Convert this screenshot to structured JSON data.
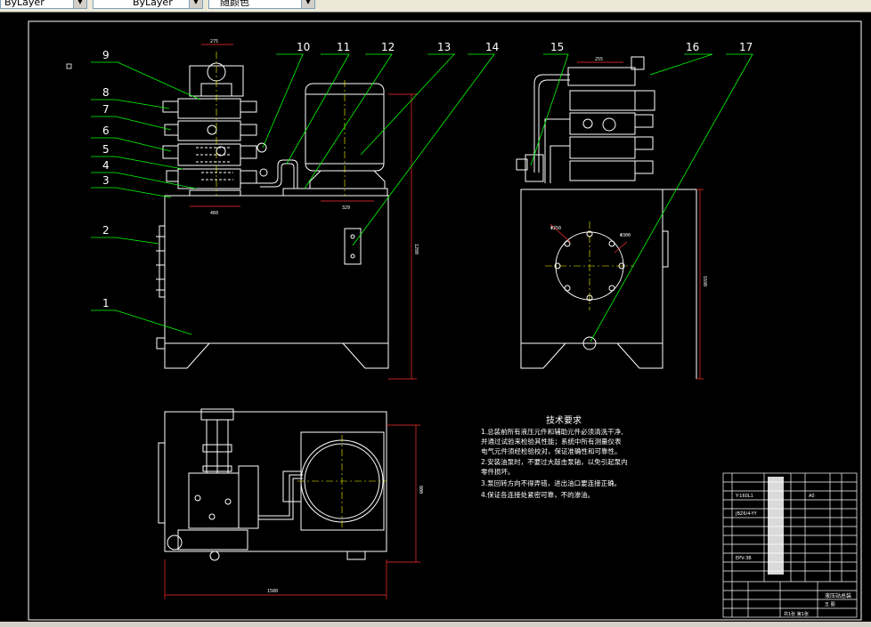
{
  "toolbar": {
    "layer_combo": "ByLayer",
    "linetype_combo": "ByLayer",
    "lineweight_combo": "随颜色"
  },
  "drawing": {
    "part_numbers": [
      "1",
      "2",
      "3",
      "4",
      "5",
      "6",
      "7",
      "8",
      "9",
      "10",
      "11",
      "12",
      "13",
      "14",
      "15",
      "16",
      "17"
    ],
    "dims": {
      "top_width": "275",
      "manifold_width": "460",
      "motor_base": "329",
      "front_height": "1280",
      "side_top": "255",
      "side_height": "1690",
      "flange_a": "Φ250",
      "flange_b": "Φ300",
      "plan_depth": "800",
      "plan_width": "1580"
    },
    "tech_title": "技术要求",
    "tech_lines": [
      "1.总装前所有液压元件和辅助元件必须清洗干净,",
      "  并通过试验来检验其性能；系统中所有测量仪表",
      "  电气元件须经检验校对，保证准确性和可靠性。",
      "2.安装油泵时，不要过大敲击泵轴，以免引起泵内",
      "  零件损坏。",
      "3.泵回转方向不得弄错，进出油口要连接正确。",
      "4.保证各连接处紧密可靠，不的渗油。"
    ],
    "title_block": {
      "code_a": "Y-160L1",
      "code_b": "JBZ6/4-YY",
      "code_c": "EPV-3B",
      "scale": "A0",
      "name": "液压站总装",
      "school": "五 图",
      "sheet": "共1张 第1张"
    }
  },
  "colors": {
    "background": "#000000",
    "outline": "#ffffff",
    "leader": "#00ff00",
    "dimension": "#ff0000",
    "text": "#ffffff",
    "center": "#ffff00"
  }
}
